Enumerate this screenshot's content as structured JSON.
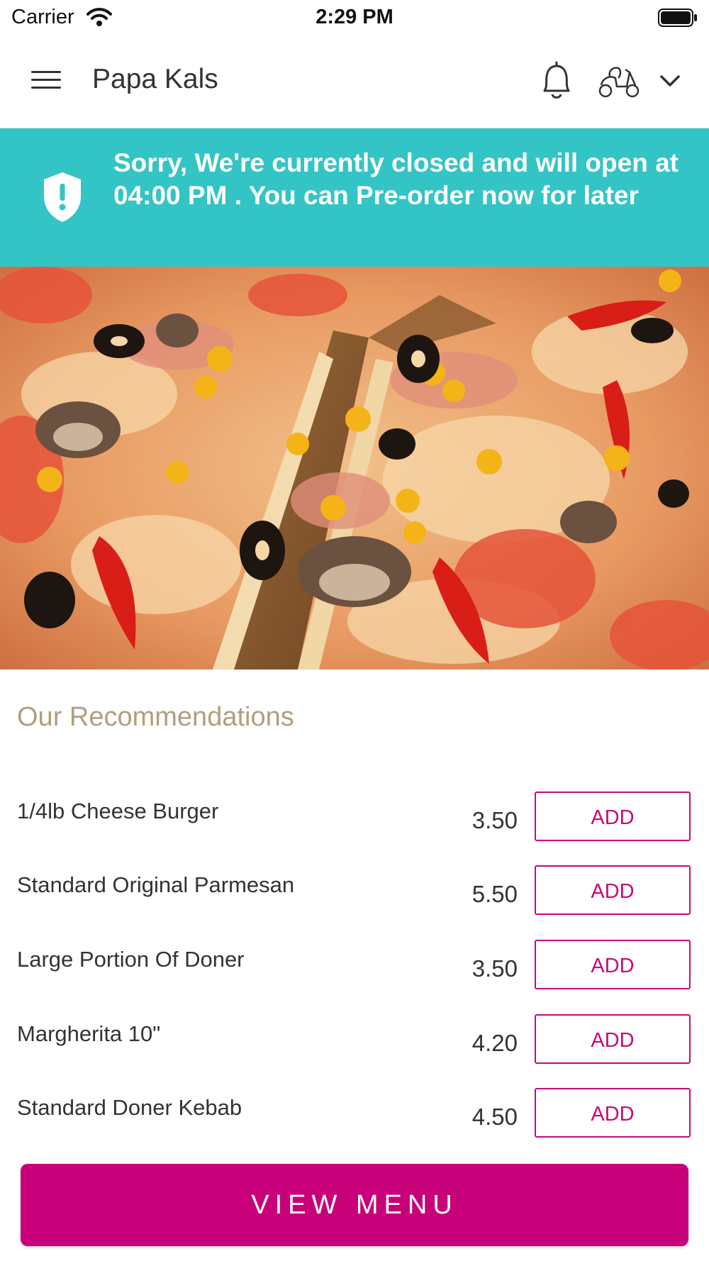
{
  "status_bar": {
    "carrier": "Carrier",
    "time": "2:29 PM"
  },
  "header": {
    "title": "Papa Kals",
    "icons": [
      "menu-icon",
      "bell-icon",
      "scooter-icon",
      "chevron-down-icon"
    ]
  },
  "banner": {
    "icon": "shield-alert-icon",
    "message": "Sorry, We're currently closed and will open at 04:00 PM . You can Pre-order now for later"
  },
  "recommendations": {
    "title": "Our Recommendations",
    "items": [
      {
        "name": "1/4lb Cheese Burger",
        "price": "3.50",
        "action": "ADD"
      },
      {
        "name": "Standard Original Parmesan",
        "price": "5.50",
        "action": "ADD"
      },
      {
        "name": "Large Portion Of Doner",
        "price": "3.50",
        "action": "ADD"
      },
      {
        "name": "Margherita 10\"",
        "price": "4.20",
        "action": "ADD"
      },
      {
        "name": "Standard Doner Kebab",
        "price": "4.50",
        "action": "ADD"
      }
    ]
  },
  "footer": {
    "view_menu_label": "VIEW MENU"
  },
  "colors": {
    "banner": "#33c4c6",
    "accent": "#c8097b",
    "section_title": "#b39e7c"
  }
}
